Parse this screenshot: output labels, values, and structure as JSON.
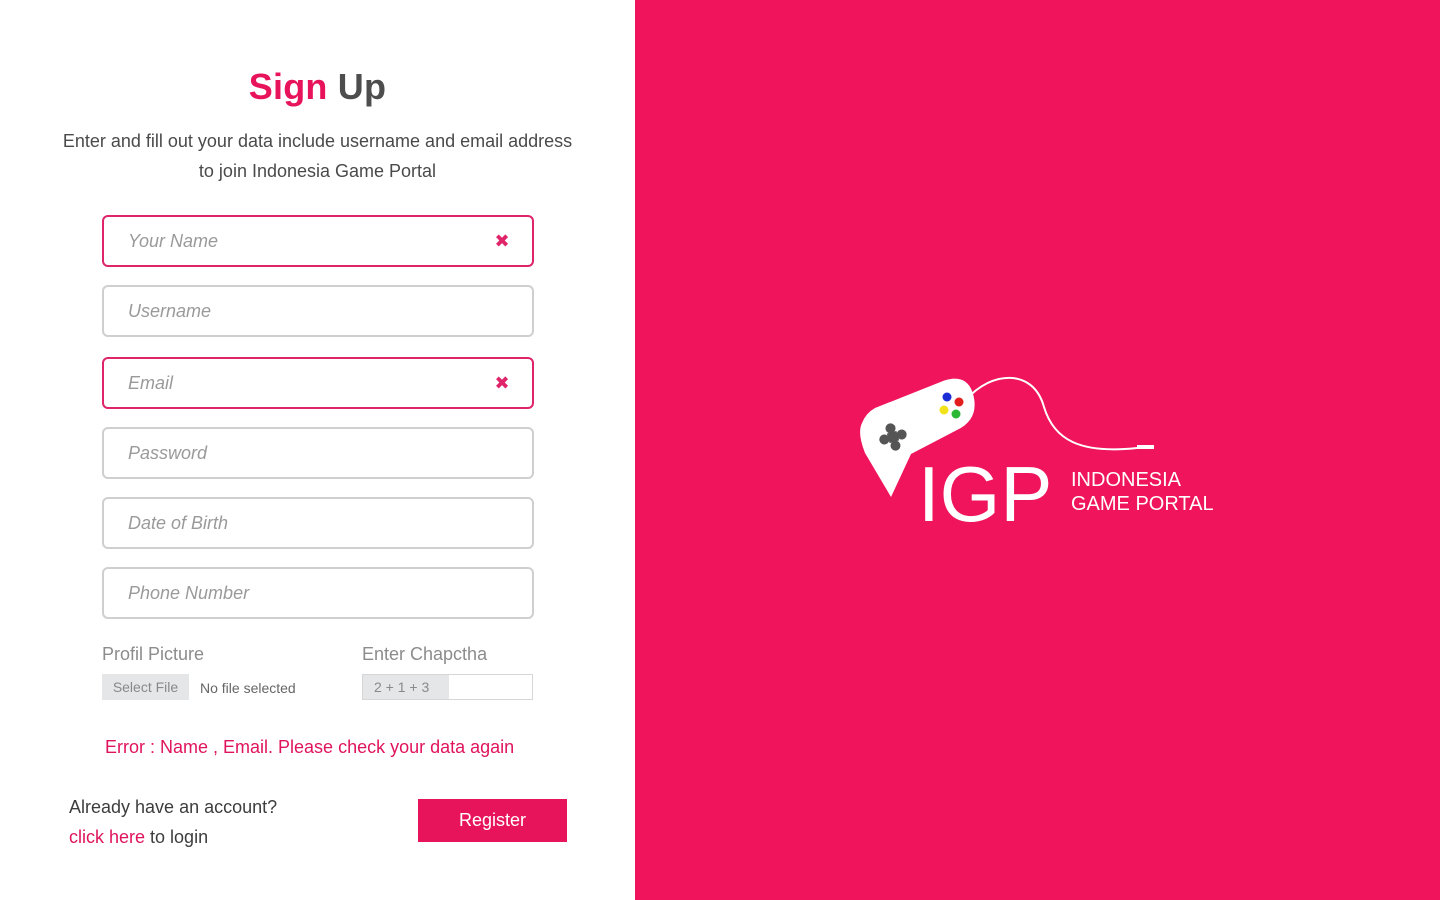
{
  "header": {
    "title_accent": "Sign",
    "title_rest": "Up",
    "subtitle_line1": "Enter and fill out your data include username and email address",
    "subtitle_line2": "to join Indonesia Game Portal"
  },
  "form": {
    "fields": [
      {
        "placeholder": "Your Name",
        "value": "",
        "error": true
      },
      {
        "placeholder": "Username",
        "value": "",
        "error": false
      },
      {
        "placeholder": "Email",
        "value": "",
        "error": true
      },
      {
        "placeholder": "Password",
        "value": "",
        "error": false
      },
      {
        "placeholder": "Date of Birth",
        "value": "",
        "error": false
      },
      {
        "placeholder": "Phone Number",
        "value": "",
        "error": false
      }
    ],
    "clear_glyph": "✖",
    "profile_picture_label": "Profil Picture",
    "select_file_label": "Select File",
    "file_status": "No file selected",
    "captcha_label": "Enter Chapctha",
    "captcha_question": "2 + 1 + 3",
    "captcha_value": ""
  },
  "error_message": "Error : Name , Email. Please check your data again",
  "footer": {
    "have_account": "Already have an account?",
    "click_here": "click here",
    "to_login": " to login",
    "register_label": "Register"
  },
  "brand": {
    "short_name": "IGP",
    "full_name_line1": "INDONESIA",
    "full_name_line2": "GAME PORTAL",
    "accent_color": "#ef145c"
  }
}
